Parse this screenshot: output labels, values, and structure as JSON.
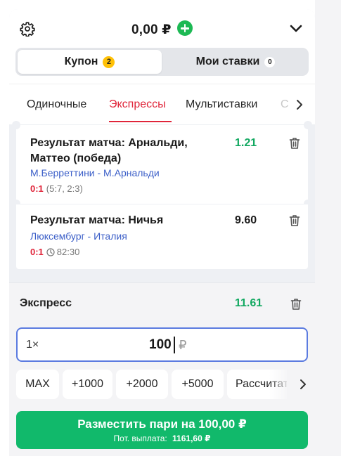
{
  "header": {
    "balance": "0,00 ₽",
    "settings_icon": "gear-icon",
    "add_funds_icon": "plus-circle-icon",
    "collapse_icon": "chevron-down-icon"
  },
  "segment": {
    "coupon_label": "Купон",
    "coupon_count": "2",
    "my_bets_label": "Мои ставки",
    "my_bets_count": "0"
  },
  "bet_tabs": {
    "items": [
      "Одиночные",
      "Экспрессы",
      "Мультиставки",
      "С"
    ],
    "active": "Экспрессы",
    "next_icon": "chevron-right-icon"
  },
  "selections": [
    {
      "market": "Результат матча: Арнальди, Маттео (победа)",
      "market_line1": "Результат матча: Арнальди,",
      "market_line2": "Маттео (победа)",
      "odds": "1.21",
      "teams": "М.Берреттини - М.Арнальди",
      "score": "0:1",
      "detail": "(5:7, 2:3)"
    },
    {
      "market": "Результат матча: Ничья",
      "odds": "9.60",
      "teams": "Люксембург - Италия",
      "score": "0:1",
      "time": "82:30"
    }
  ],
  "express": {
    "label": "Экспресс",
    "total_odds": "11.61"
  },
  "stake_input": {
    "multiplier": "1×",
    "value": "100",
    "currency": "₽"
  },
  "quick_amounts": [
    "MAX",
    "+1000",
    "+2000",
    "+5000",
    "Рассчитать"
  ],
  "place_bet": {
    "label": "Разместить пари на 100,00 ₽",
    "payout_label": "Пот. выплата:",
    "payout_value": "1161,60 ₽"
  },
  "colors": {
    "accent_red": "#e0253a",
    "odds_green": "#11a860",
    "button_green": "#11b96b",
    "link_blue": "#3c5fc8",
    "badge_yellow": "#ffc107",
    "input_border": "#5b7be0"
  }
}
